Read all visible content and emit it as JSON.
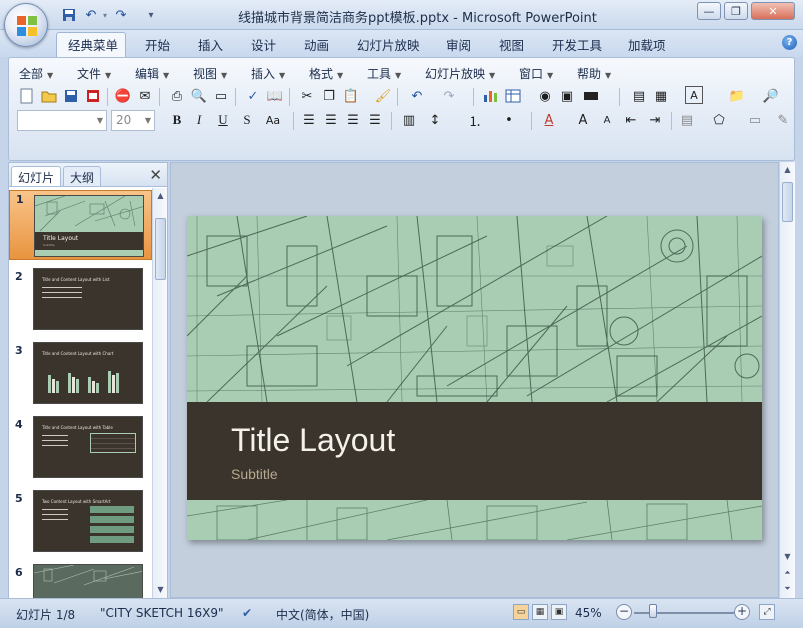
{
  "window": {
    "title": "线描城市背景简洁商务ppt模板.pptx - Microsoft PowerPoint",
    "minimize_glyph": "—",
    "restore_glyph": "❐",
    "close_glyph": "✕"
  },
  "quick_access": {
    "save_icon": "save-icon",
    "undo_glyph": "↶",
    "redo_glyph": "↷",
    "customize_glyph": "▾"
  },
  "tabs": [
    "经典菜单",
    "开始",
    "插入",
    "设计",
    "动画",
    "幻灯片放映",
    "审阅",
    "视图",
    "开发工具",
    "加载项"
  ],
  "active_tab": 0,
  "help_glyph": "?",
  "menus": [
    "全部",
    "文件",
    "编辑",
    "视图",
    "插入",
    "格式",
    "工具",
    "幻灯片放映",
    "窗口",
    "帮助"
  ],
  "font_combo": {
    "value": ""
  },
  "size_combo": {
    "value": "20"
  },
  "format_buttons": [
    "B",
    "I",
    "U",
    "S",
    "Aa"
  ],
  "left_pane": {
    "tabs": [
      "幻灯片",
      "大纲"
    ],
    "active_tab": 0,
    "close_glyph": "✕",
    "thumbnails": [
      {
        "num": "1",
        "title": "Title Layout",
        "subtitle": "Subtitle"
      },
      {
        "num": "2",
        "title": "Title and Content Layout with List"
      },
      {
        "num": "3",
        "title": "Title and Content Layout with Chart"
      },
      {
        "num": "4",
        "title": "Title and Content Layout with Table"
      },
      {
        "num": "5",
        "title": "Two Content Layout with SmartArt"
      },
      {
        "num": "6",
        "title": ""
      }
    ],
    "selected": 0
  },
  "slide": {
    "title": "Title Layout",
    "subtitle": "Subtitle",
    "colors": {
      "band": "#3b342d",
      "sketch_bg": "#a8cdb3",
      "title": "#f4f1ea",
      "subtitle": "#b5a98f"
    }
  },
  "status": {
    "slide_indicator": "幻灯片 1/8",
    "theme": "\"CITY SKETCH 16X9\"",
    "language": "中文(简体，中国)",
    "zoom_label": "45%",
    "zoom_level": 0.45,
    "zoom_out_glyph": "−",
    "zoom_in_glyph": "+"
  },
  "colors": {
    "accent": "#1a5fb8",
    "ribbon_bg": "#e3ebf6",
    "selection": "#f3a24a"
  }
}
